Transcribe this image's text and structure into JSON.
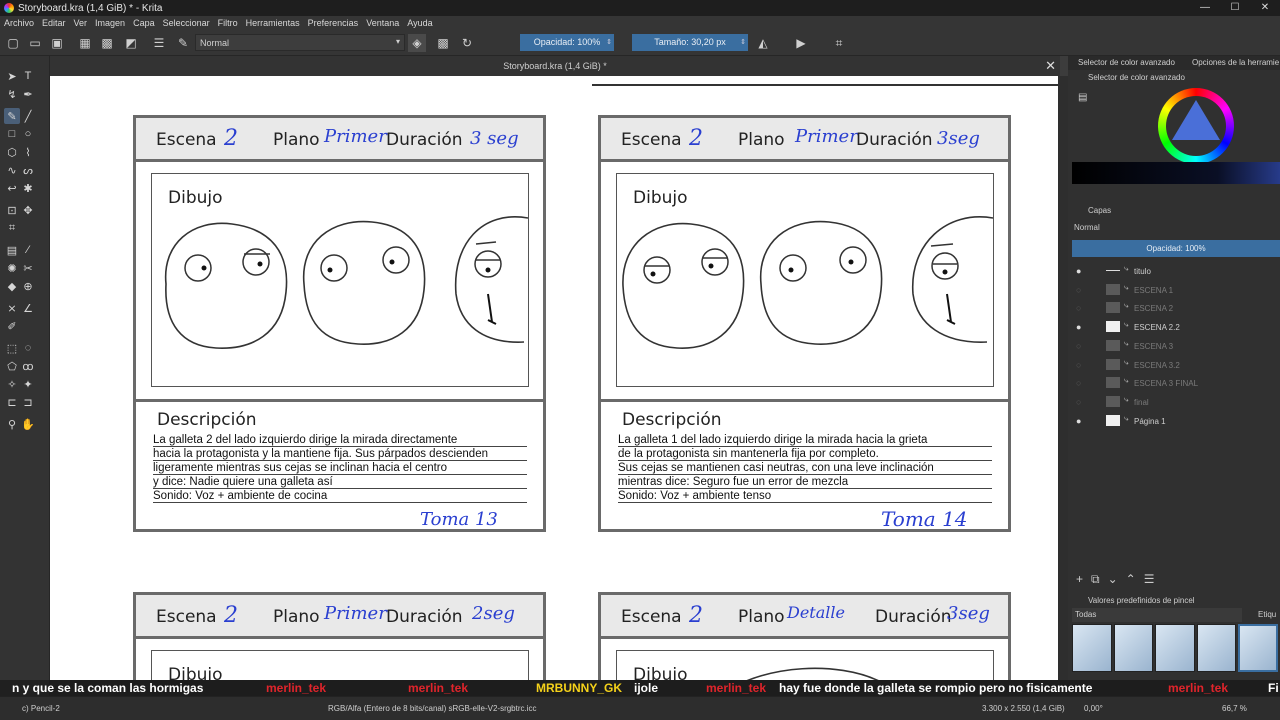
{
  "window": {
    "title": "Storyboard.kra (1,4 GiB) * - Krita",
    "buttons": [
      "—",
      "☐",
      "✕"
    ]
  },
  "menu": [
    "Archivo",
    "Editar",
    "Ver",
    "Imagen",
    "Capa",
    "Seleccionar",
    "Filtro",
    "Herramientas",
    "Preferencias",
    "Ventana",
    "Ayuda"
  ],
  "toolbar": {
    "blend_mode": "Normal",
    "opacity": "Opacidad: 100%",
    "size": "Tamaño: 30,20 px"
  },
  "document": {
    "tab_title": "Storyboard.kra (1,4 GiB) *",
    "panels": [
      {
        "escena_label": "Escena",
        "escena_value": "2",
        "plano_label": "Plano",
        "plano_value": "Primer",
        "duracion_label": "Duración",
        "duracion_value": "3 seg",
        "dibujo_label": "Dibujo",
        "descripcion_label": "Descripción",
        "lines": [
          "La galleta 2 del lado izquierdo dirige la mirada directamente",
          "hacia la protagonista y la mantiene fija. Sus párpados descienden",
          " ligeramente mientras sus cejas se inclinan hacia el centro",
          "y dice: Nadie quiere una galleta así",
          "Sonido: Voz + ambiente de cocina"
        ],
        "toma": "Toma 13"
      },
      {
        "escena_label": "Escena",
        "escena_value": "2",
        "plano_label": "Plano",
        "plano_value": "Primer",
        "duracion_label": "Duración",
        "duracion_value": "3seg",
        "dibujo_label": "Dibujo",
        "descripcion_label": "Descripción",
        "lines": [
          "La galleta 1 del lado izquierdo dirige la mirada hacia la grieta",
          "de la protagonista sin mantenerla fija por completo.",
          "Sus cejas se mantienen casi neutras, con una leve inclinación",
          " mientras dice: Seguro fue un error de mezcla",
          "Sonido: Voz + ambiente tenso"
        ],
        "toma": "Toma 14"
      },
      {
        "escena_label": "Escena",
        "escena_value": "2",
        "plano_label": "Plano",
        "plano_value": "Primer",
        "duracion_label": "Duración",
        "duracion_value": "2seg",
        "dibujo_label": "Dibujo"
      },
      {
        "escena_label": "Escena",
        "escena_value": "2",
        "plano_label": "Plano",
        "plano_value": "Detalle",
        "duracion_label": "Duración",
        "duracion_value": "3seg",
        "dibujo_label": "Dibujo"
      }
    ]
  },
  "right_panel": {
    "tabs": [
      "Selector de color avanzado",
      "Opciones de la herramie"
    ],
    "color_header": "Selector de color avanzado",
    "layers_header": "Capas",
    "layers_blend": "Normal",
    "layers_opacity": "Opacidad: 100%",
    "layers": [
      {
        "name": "titulo",
        "visible": true,
        "dim": false,
        "thumb": "line"
      },
      {
        "name": "ESCENA 1",
        "visible": false,
        "dim": true,
        "thumb": "dark"
      },
      {
        "name": "ESCENA 2",
        "visible": false,
        "dim": true,
        "thumb": "dark"
      },
      {
        "name": "ESCENA 2.2",
        "visible": true,
        "dim": false,
        "thumb": "white"
      },
      {
        "name": "ESCENA 3",
        "visible": false,
        "dim": true,
        "thumb": "dark"
      },
      {
        "name": "ESCENA 3.2",
        "visible": false,
        "dim": true,
        "thumb": "dark"
      },
      {
        "name": "ESCENA 3 FINAL",
        "visible": false,
        "dim": true,
        "thumb": "dark"
      },
      {
        "name": "final",
        "visible": false,
        "dim": true,
        "thumb": "dark"
      },
      {
        "name": "Página 1",
        "visible": true,
        "dim": false,
        "thumb": "white"
      }
    ],
    "brush_header": "Valores predefinidos de pincel",
    "brush_filter": "Todas",
    "brush_tag": "Etiqu"
  },
  "chat": [
    {
      "text": "n y que se la coman las hormigas",
      "style": "w"
    },
    {
      "text": "merlin_tek",
      "style": "r"
    },
    {
      "text": "merlin_tek",
      "style": "r"
    },
    {
      "text": "MRBUNNY_GK",
      "style": "y"
    },
    {
      "text": "ijole",
      "style": "w"
    },
    {
      "text": "merlin_tek",
      "style": "r"
    },
    {
      "text": "hay fue donde la galleta se rompio pero no fisicamente",
      "style": "w"
    },
    {
      "text": "merlin_tek",
      "style": "r"
    },
    {
      "text": "Fi",
      "style": "w"
    }
  ],
  "status": {
    "brush": "c) Pencil-2",
    "color_model": "RGB/Alfa (Entero de 8 bits/canal)  sRGB-elle-V2-srgbtrc.icc",
    "dimensions": "3.300 x 2.550 (1,4 GiB)",
    "rotation": "0,00°",
    "zoom": "66,7 %"
  },
  "colors": {
    "accent": "#3a6ea0",
    "handwriting": "#2a3fd0",
    "chat_user": "#e0242b"
  }
}
